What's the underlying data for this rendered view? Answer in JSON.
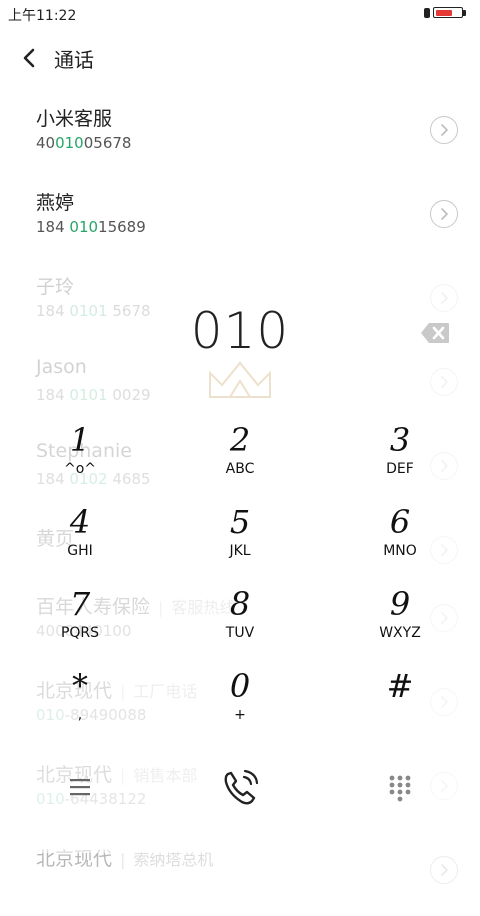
{
  "status": {
    "time": "上午11:22",
    "battery_color": "#e53935",
    "battery_level": 0.7
  },
  "header": {
    "back_icon": "chevron-left-icon",
    "title": "通话"
  },
  "contacts": [
    {
      "name": "小米客服",
      "tag": "",
      "number_pre": "40",
      "number_hl": "010",
      "number_post": "05678"
    },
    {
      "name": "燕婷",
      "tag": "",
      "number_pre": "184 ",
      "number_hl": "010",
      "number_post": "15689"
    },
    {
      "name": "子玲",
      "tag": "",
      "number_pre": "184 ",
      "number_hl": "0101",
      "number_post": " 5678"
    },
    {
      "name": "Jason",
      "tag": "",
      "number_pre": "184 ",
      "number_hl": "0101",
      "number_post": " 0029"
    },
    {
      "name": "Stephanie",
      "tag": "",
      "number_pre": "184 ",
      "number_hl": "0102",
      "number_post": " 4685"
    },
    {
      "name": "黄页",
      "tag": "",
      "number_pre": "",
      "number_hl": "",
      "number_post": ""
    },
    {
      "name": "百年人寿保险",
      "tag": "客服热线",
      "number_pre": "40084",
      "number_hl": "",
      "number_post": "40100"
    },
    {
      "name": "北京现代",
      "tag": "工厂电话",
      "number_pre": "",
      "number_hl": "010",
      "number_post": "-89490088"
    },
    {
      "name": "北京现代",
      "tag": "销售本部",
      "number_pre": "",
      "number_hl": "010",
      "number_post": "-64438122"
    },
    {
      "name": "北京现代",
      "tag": "索纳塔总机",
      "number_pre": "",
      "number_hl": "",
      "number_post": ""
    }
  ],
  "dial": {
    "number": "010",
    "backspace_icon": "backspace-icon"
  },
  "keypad": [
    {
      "digit": "1",
      "letters": "^o^"
    },
    {
      "digit": "2",
      "letters": "ABC"
    },
    {
      "digit": "3",
      "letters": "DEF"
    },
    {
      "digit": "4",
      "letters": "GHI"
    },
    {
      "digit": "5",
      "letters": "JKL"
    },
    {
      "digit": "6",
      "letters": "MNO"
    },
    {
      "digit": "7",
      "letters": "PQRS"
    },
    {
      "digit": "8",
      "letters": "TUV"
    },
    {
      "digit": "9",
      "letters": "WXYZ"
    },
    {
      "digit": "*",
      "letters": ","
    },
    {
      "digit": "0",
      "letters": "+"
    },
    {
      "digit": "#",
      "letters": ""
    }
  ],
  "bottom_bar": {
    "menu_icon": "menu-icon",
    "call_icon": "phone-call-icon",
    "keypad_icon": "dialpad-icon",
    "accent": "#222222"
  }
}
